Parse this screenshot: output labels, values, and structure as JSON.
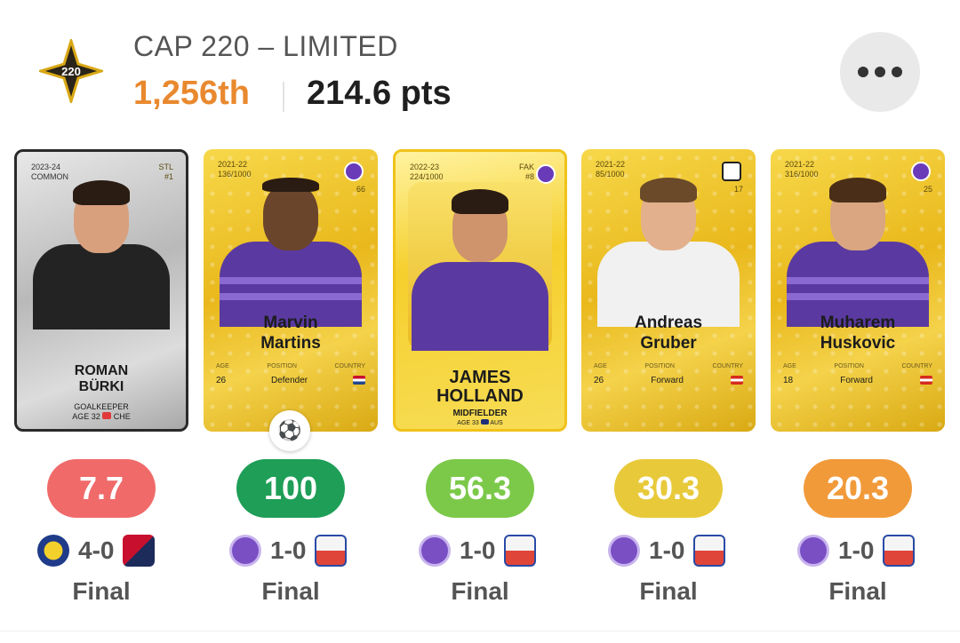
{
  "contest": {
    "logo_text": "220",
    "title": "CAP 220 – LIMITED",
    "rank": "1,256th",
    "points": "214.6 pts",
    "more_icon": "ellipsis-icon"
  },
  "colors": {
    "rank_orange": "#e9892f",
    "score_red": "#f06a6a",
    "score_green_dark": "#1e9e57",
    "score_green_light": "#7cc94a",
    "score_yellow": "#e8c93a",
    "score_orange": "#f19a3a"
  },
  "cards": [
    {
      "season": "2023-24",
      "rarity": "COMMON",
      "club_code": "STL",
      "number": "#1",
      "first_name": "ROMAN",
      "last_name": "BÜRKI",
      "position": "GOALKEEPER",
      "age_line": "AGE 32",
      "country": "CHE",
      "score": "7.7",
      "home_score": "4-0",
      "status": "Final"
    },
    {
      "season": "2021-22",
      "serial": "136/1000",
      "jersey": "66",
      "first_name": "Marvin",
      "last_name": "Martins",
      "age_label": "AGE",
      "position_label": "POSITION",
      "country_label": "COUNTRY",
      "age": "26",
      "position": "Defender",
      "score": "100",
      "home_score": "1-0",
      "status": "Final"
    },
    {
      "season": "2022-23",
      "serial": "224/1000",
      "club_code": "FAK",
      "number": "#8",
      "first_name": "JAMES",
      "last_name": "HOLLAND",
      "position": "MIDFIELDER",
      "age_line": "AGE 33",
      "country": "AUS",
      "score": "56.3",
      "home_score": "1-0",
      "status": "Final"
    },
    {
      "season": "2021-22",
      "serial": "85/1000",
      "jersey": "17",
      "first_name": "Andreas",
      "last_name": "Gruber",
      "age_label": "AGE",
      "position_label": "POSITION",
      "country_label": "COUNTRY",
      "age": "26",
      "position": "Forward",
      "score": "30.3",
      "home_score": "1-0",
      "status": "Final"
    },
    {
      "season": "2021-22",
      "serial": "316/1000",
      "jersey": "25",
      "first_name": "Muharem",
      "last_name": "Huskovic",
      "age_label": "AGE",
      "position_label": "POSITION",
      "country_label": "COUNTRY",
      "age": "18",
      "position": "Forward",
      "score": "20.3",
      "home_score": "1-0",
      "status": "Final"
    }
  ]
}
